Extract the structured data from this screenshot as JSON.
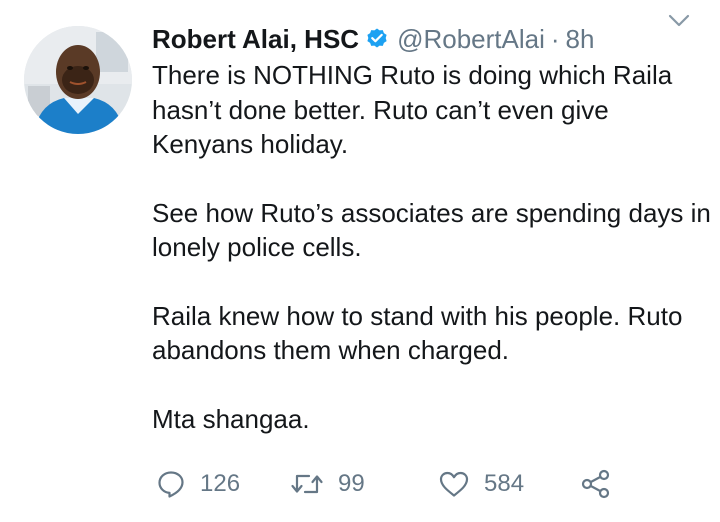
{
  "tweet": {
    "author": {
      "name": "Robert Alai, HSC",
      "handle": "@RobertAlai",
      "verified": true
    },
    "separator": "·",
    "time": "8h",
    "paragraphs": [
      "There is NOTHING Ruto is doing which Raila hasn’t done better. Ruto can’t even give Kenyans holiday.",
      "See how Ruto’s associates are spending days in lonely police cells.",
      "Raila knew how to stand with his people. Ruto abandons them when charged.",
      "Mta shangaa."
    ],
    "actions": {
      "replies": "126",
      "retweets": "99",
      "likes": "584"
    }
  },
  "colors": {
    "text": "#14171a",
    "muted": "#657786",
    "verified_badge": "#1da1f2"
  },
  "icons": [
    "avatar-photo",
    "verified-badge-icon",
    "chevron-down-icon",
    "reply-icon",
    "retweet-icon",
    "like-icon",
    "share-icon"
  ]
}
